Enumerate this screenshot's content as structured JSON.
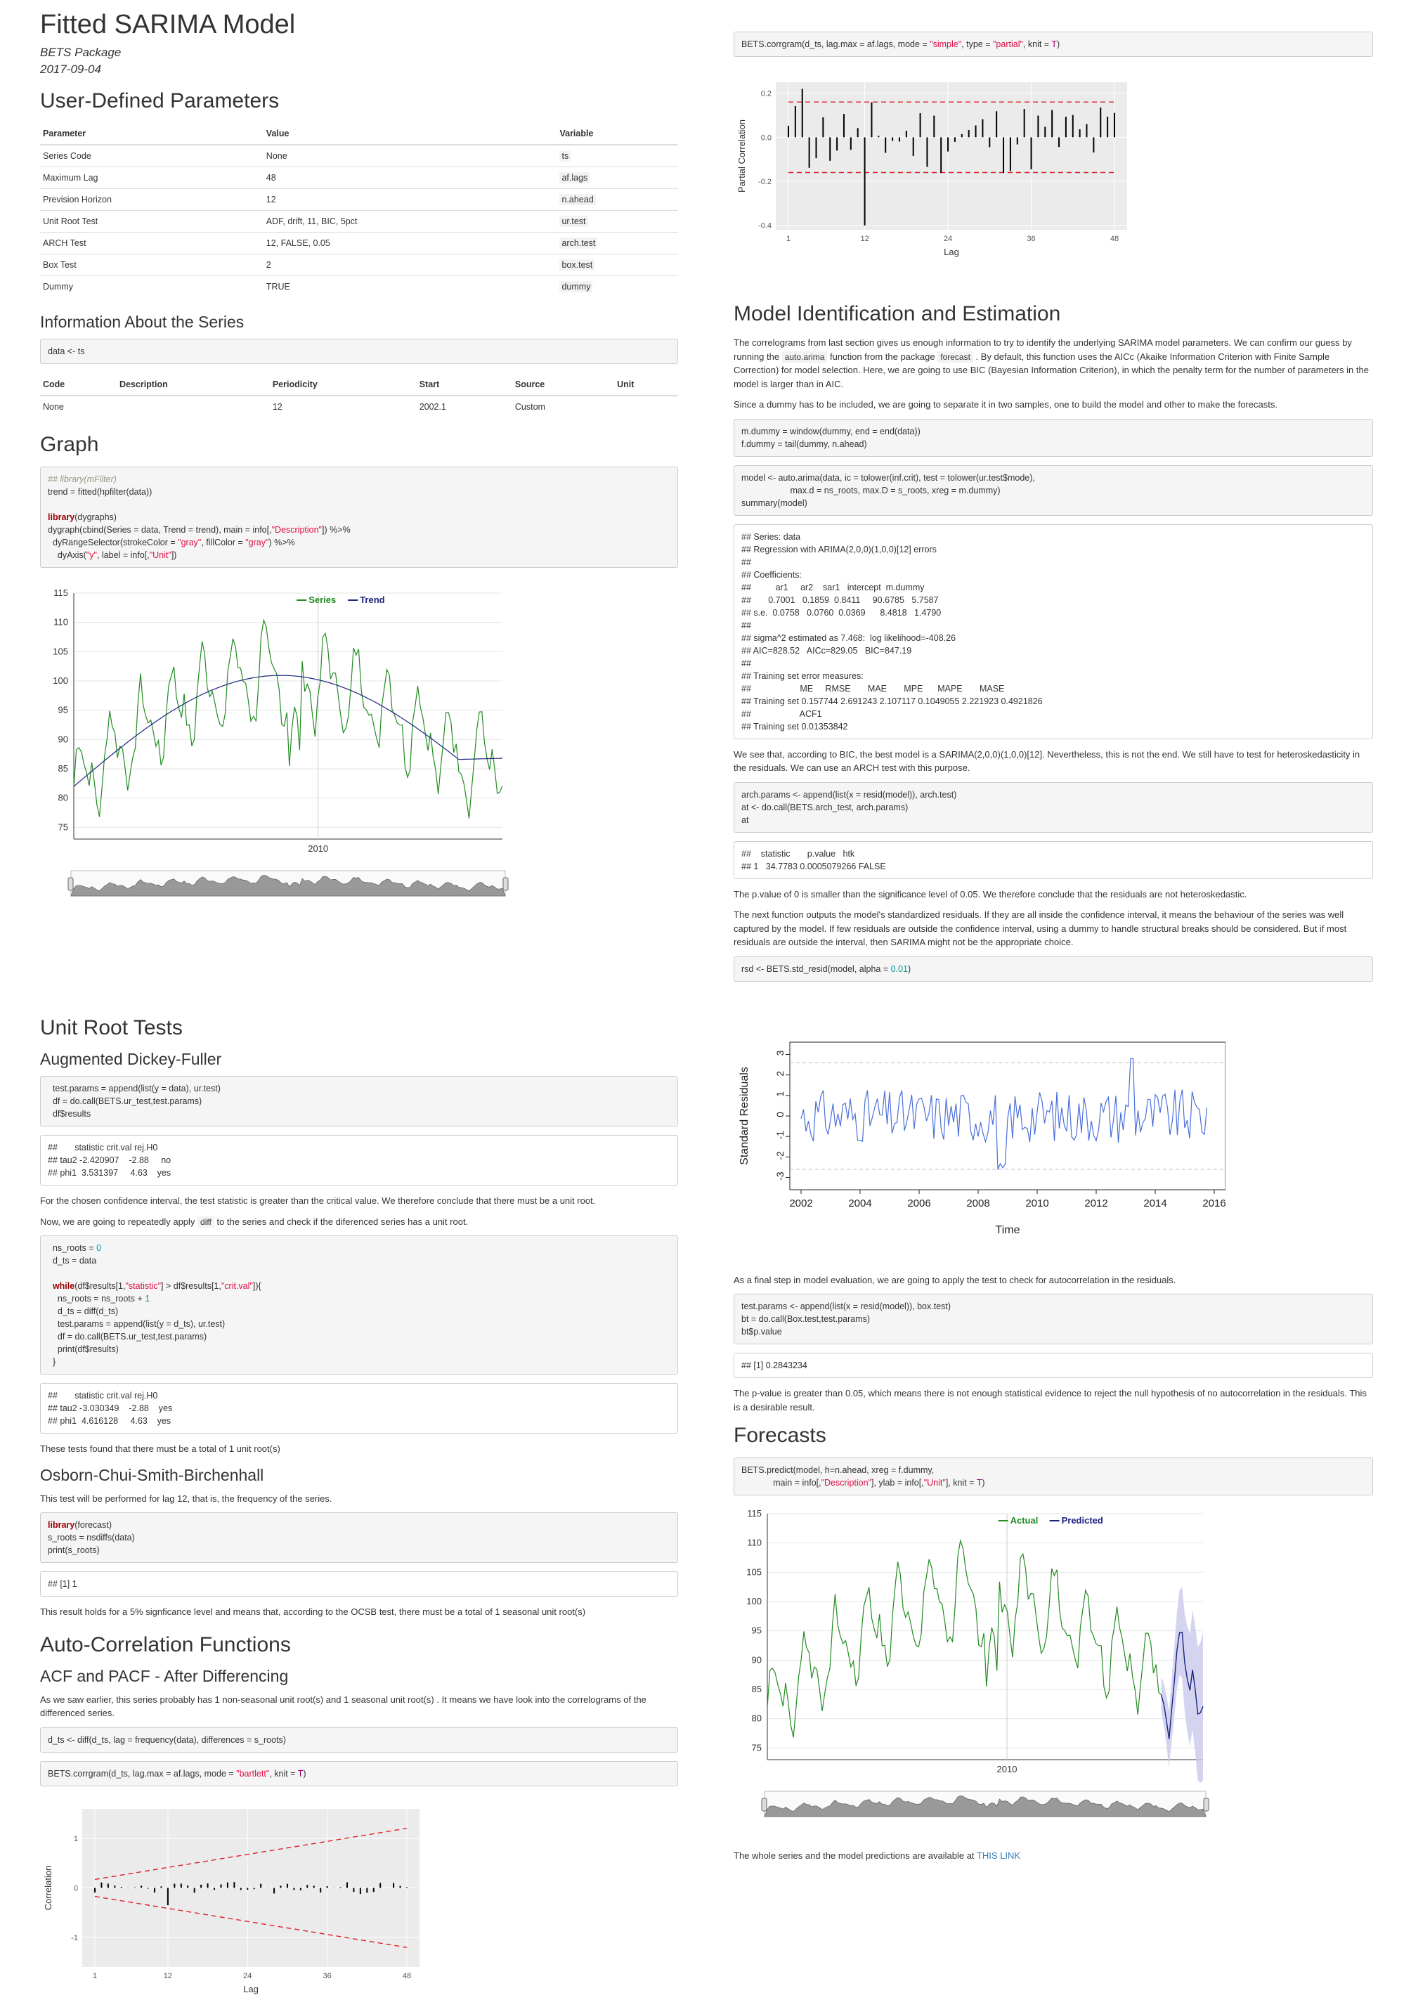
{
  "title": "Fitted SARIMA Model",
  "author": "BETS Package",
  "date": "2017-09-04",
  "params_heading": "User-Defined Parameters",
  "params": {
    "headers": [
      "Parameter",
      "Value",
      "Variable"
    ],
    "rows": [
      [
        "Series Code",
        "None",
        "ts"
      ],
      [
        "Maximum Lag",
        "48",
        "af.lags"
      ],
      [
        "Prevision Horizon",
        "12",
        "n.ahead"
      ],
      [
        "Unit Root Test",
        "ADF, drift, 11, BIC, 5pct",
        "ur.test"
      ],
      [
        "ARCH Test",
        "12, FALSE, 0.05",
        "arch.test"
      ],
      [
        "Box Test",
        "2",
        "box.test"
      ],
      [
        "Dummy",
        "TRUE",
        "dummy"
      ]
    ]
  },
  "info_heading": "Information About the Series",
  "info_code": "data <- ts",
  "info": {
    "headers": [
      "Code",
      "Description",
      "Periodicity",
      "Start",
      "Source",
      "Unit"
    ],
    "row": [
      "None",
      "",
      "12",
      "2002.1",
      "Custom",
      ""
    ]
  },
  "graph_heading": "Graph",
  "dygraph1": {
    "legend_a": "Series",
    "legend_b": "Trend",
    "y_ticks": [
      "115",
      "110",
      "105",
      "100",
      "95",
      "90",
      "85",
      "80",
      "75"
    ],
    "x_tick": "2010"
  },
  "unit_root_heading": "Unit Root Tests",
  "adf_heading": "Augmented Dickey-Fuller",
  "adf_out1": "##       statistic crit.val rej.H0\n## tau2 -2.420907    -2.88     no\n## phi1  3.531397     4.63    yes",
  "adf_p1": "For the chosen confidence interval, the test statistic is greater than the critical value. We therefore conclude that there must be a unit root.",
  "adf_p2a": "Now, we are going to repeatedly apply",
  "adf_p2code": "diff",
  "adf_p2b": "to the series and check if the diferenced series has a unit root.",
  "adf_out2": "##       statistic crit.val rej.H0\n## tau2 -3.030349    -2.88    yes\n## phi1  4.616128     4.63    yes",
  "adf_p3": "These tests found that there must be a total of 1 unit root(s)",
  "ocsb_heading": "Osborn-Chui-Smith-Birchenhall",
  "ocsb_p1": "This test will be performed for lag 12, that is, the frequency of the series.",
  "ocsb_out": "## [1] 1",
  "ocsb_p2": "This result holds for a 5% signficance level and means that, according to the OCSB test, there must be a total of 1 seasonal unit root(s)",
  "acf_heading": "Auto-Correlation Functions",
  "acf_sub": "ACF and PACF - After Differencing",
  "acf_p1": "As we saw earlier, this series probably has 1 non-seasonal unit root(s) and 1 seasonal unit root(s) . It means we have look into the correlograms of the differenced series.",
  "acf_chart": {
    "ylabel": "Correlation",
    "xlabel": "Lag",
    "x_ticks": [
      "1",
      "12",
      "24",
      "36",
      "48"
    ],
    "y_ticks": [
      "1",
      "0",
      "-1"
    ]
  },
  "pacf_chart": {
    "ylabel": "Partial Correlation",
    "xlabel": "Lag",
    "x_ticks": [
      "1",
      "12",
      "24",
      "36",
      "48"
    ],
    "y_ticks": [
      "0.2",
      "0.0",
      "-0.2",
      "-0.4"
    ]
  },
  "model_heading": "Model Identification and Estimation",
  "model_p1a": "The correlograms from last section gives us enough information to try to identify the underlying SARIMA model parameters. We can confirm our guess by running the",
  "model_p1c1": "auto.arima",
  "model_p1b": "function from the package",
  "model_p1c2": "forecast",
  "model_p1d": ". By default, this function uses the AICc (Akaike Information Criterion with Finite Sample Correction) for model selection. Here, we are going to use BIC (Bayesian Information Criterion), in which the penalty term for the number of parameters in the model is larger than in AIC.",
  "model_p2": "Since a dummy has to be included, we are going to separate it in two samples, one to build the model and other to make the forecasts.",
  "model_out": "## Series: data\n## Regression with ARIMA(2,0,0)(1,0,0)[12] errors\n##\n## Coefficients:\n##          ar1     ar2    sar1   intercept  m.dummy\n##       0.7001   0.1859  0.8411     90.6785   5.7587\n## s.e.  0.0758   0.0760  0.0369      8.4818   1.4790\n##\n## sigma^2 estimated as 7.468:  log likelihood=-408.26\n## AIC=828.52   AICc=829.05   BIC=847.19\n##\n## Training set error measures:\n##                    ME     RMSE       MAE       MPE      MAPE       MASE\n## Training set 0.157744 2.691243 2.107117 0.1049055 2.221923 0.4921826\n##                    ACF1\n## Training set 0.01353842",
  "model_p3": "We see that, according to BIC, the best model is a SARIMA(2,0,0)(1,0,0)[12]. Nevertheless, this is not the end. We still have to test for heteroskedasticity in the residuals. We can use an ARCH test with this purpose.",
  "arch_out": "##    statistic       p.value   htk\n## 1   34.7783 0.0005079266 FALSE",
  "model_p4": "The p.value of 0 is smaller than the significance level of 0.05. We therefore conclude that the residuals are not heteroskedastic.",
  "model_p5": "The next function outputs the model's standardized residuals. If they are all inside the confidence interval, it means the behaviour of the series was well captured by the model. If few residuals are outside the confidence interval, using a dummy to handle structural breaks should be considered. But if most residuals are outside the interval, then SARIMA might not be the appropriate choice.",
  "resid_chart": {
    "ylabel": "Standard Residuals",
    "xlabel": "Time",
    "x_ticks": [
      "2002",
      "2004",
      "2006",
      "2008",
      "2010",
      "2012",
      "2014",
      "2016"
    ],
    "y_ticks": [
      "3",
      "2",
      "1",
      "0",
      "-1",
      "-2",
      "-3"
    ]
  },
  "box_p1": "As a final step in model evaluation, we are going to apply the test to check for autocorrelation in the residuals.",
  "box_out": "## [1] 0.2843234",
  "box_p2": "The p-value is greater than 0.05, which means there is not enough statistical evidence to reject the null hypothesis of no autocorrelation in the residuals. This is a desirable result.",
  "fc_heading": "Forecasts",
  "dygraph2": {
    "legend_a": "Actual",
    "legend_b": "Predicted",
    "y_ticks": [
      "115",
      "110",
      "105",
      "100",
      "95",
      "90",
      "85",
      "80",
      "75"
    ],
    "x_tick": "2010"
  },
  "final_p": "The whole series and the model predictions are available at",
  "final_link": "THIS LINK",
  "colors": {
    "series": "#228b22",
    "trend": "#1a237e",
    "ci": "#dd2222",
    "resid": "#4a6fdc",
    "band": "#c9c9ee"
  }
}
